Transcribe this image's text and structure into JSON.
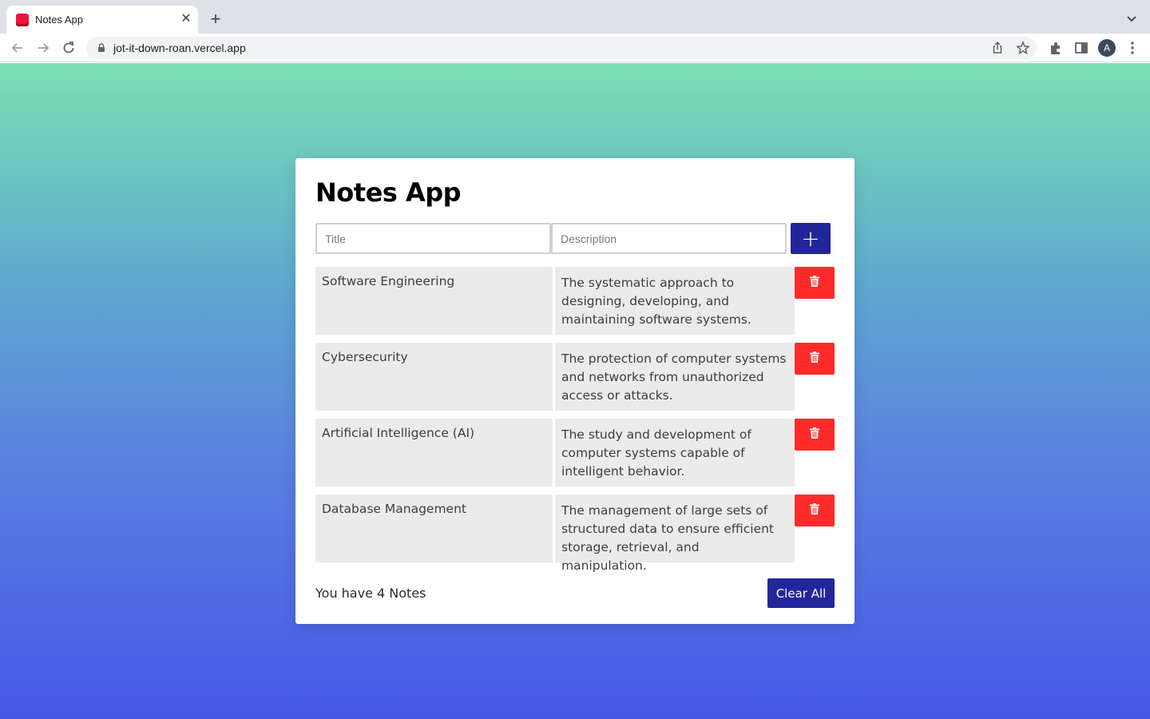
{
  "browser": {
    "tab_title": "Notes App",
    "url": "jot-it-down-roan.vercel.app",
    "avatar_letter": "A"
  },
  "app": {
    "title": "Notes App",
    "title_placeholder": "Title",
    "description_placeholder": "Description",
    "add_label": "+",
    "notes": [
      {
        "title": "Software Engineering",
        "description": "The systematic approach to designing, developing, and maintaining software systems."
      },
      {
        "title": "Cybersecurity",
        "description": "The protection of computer systems and networks from unauthorized access or attacks."
      },
      {
        "title": "Artificial Intelligence (AI)",
        "description": "The study and development of computer systems capable of intelligent behavior."
      },
      {
        "title": "Database Management",
        "description": "The management of large sets of structured data to ensure efficient storage, retrieval, and manipulation."
      }
    ],
    "count_text": "You have 4 Notes",
    "clear_label": "Clear All"
  },
  "colors": {
    "primary": "#23259a",
    "danger": "#ff2b2b",
    "gradient_top": "#7be0b3",
    "gradient_bottom": "#4558e8"
  },
  "icons": [
    "back-arrow-icon",
    "forward-arrow-icon",
    "reload-icon",
    "lock-icon",
    "share-icon",
    "star-icon",
    "extensions-icon",
    "side-panel-icon",
    "kebab-menu-icon",
    "trash-icon"
  ]
}
